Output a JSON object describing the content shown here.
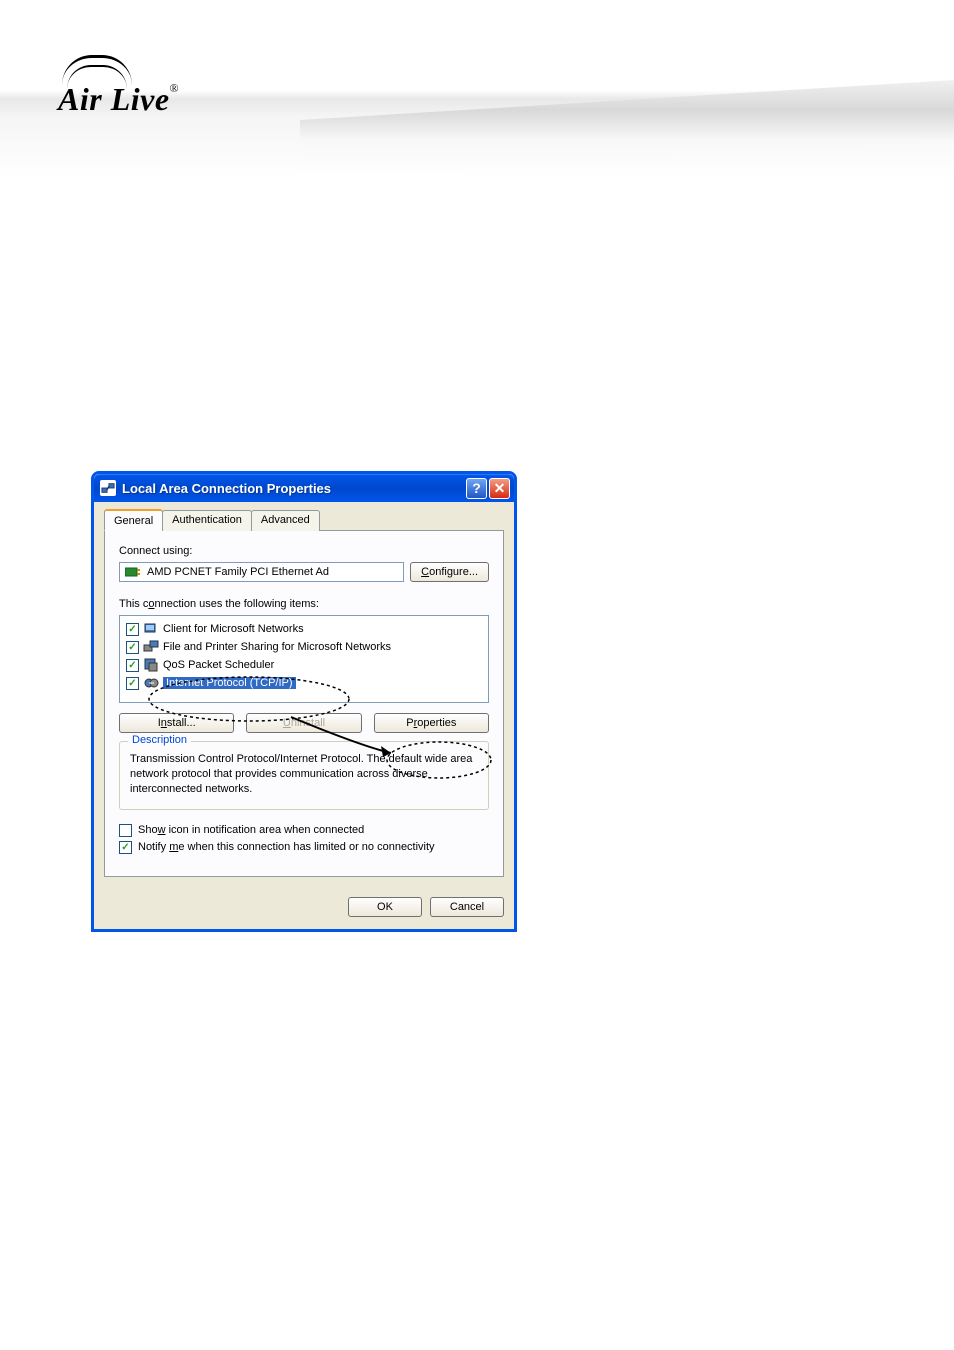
{
  "logo": {
    "text": "Air Live",
    "reg": "®"
  },
  "dialog": {
    "title": "Local Area Connection Properties",
    "tabs": [
      "General",
      "Authentication",
      "Advanced"
    ],
    "connect_using_label": "Connect using:",
    "adapter": "AMD PCNET Family PCI Ethernet Ad",
    "configure_btn": "Configure...",
    "items_label": "This connection uses the following items:",
    "items": [
      {
        "label": "Client for Microsoft Networks",
        "checked": true
      },
      {
        "label": "File and Printer Sharing for Microsoft Networks",
        "checked": true
      },
      {
        "label": "QoS Packet Scheduler",
        "checked": true
      },
      {
        "label": "Internet Protocol (TCP/IP)",
        "checked": true,
        "selected": true
      }
    ],
    "install_btn": "Install...",
    "uninstall_btn": "Uninstall",
    "properties_btn": "Properties",
    "description_title": "Description",
    "description_text": "Transmission Control Protocol/Internet Protocol. The default wide area network protocol that provides communication across diverse interconnected networks.",
    "show_icon_label": "Show icon in notification area when connected",
    "show_icon_checked": false,
    "notify_label": "Notify me when this connection has limited or no connectivity",
    "notify_checked": true,
    "ok_btn": "OK",
    "cancel_btn": "Cancel"
  }
}
